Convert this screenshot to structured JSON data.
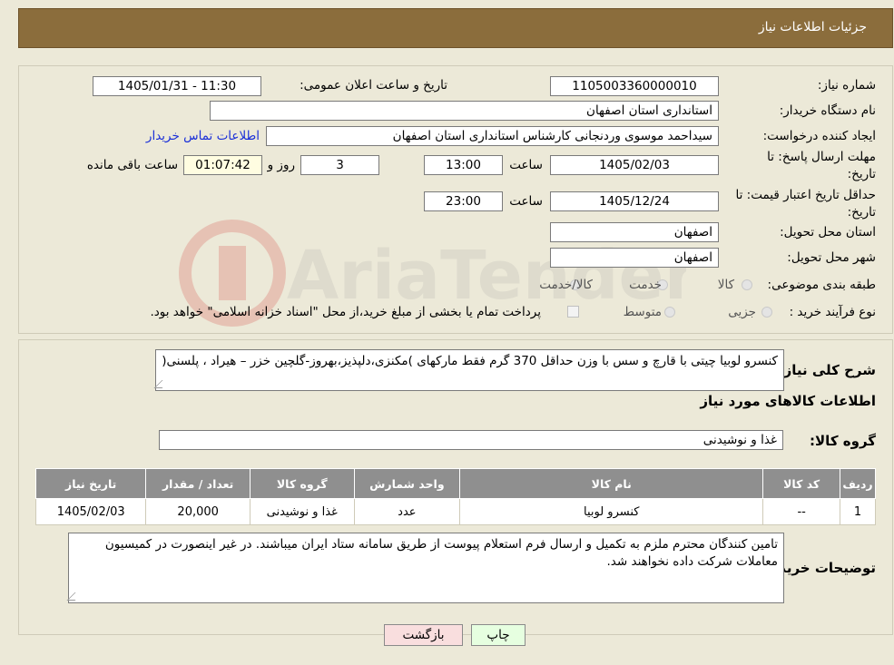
{
  "header": {
    "title": "جزئیات اطلاعات نیاز"
  },
  "fields": {
    "need_number_label": "شماره نیاز:",
    "need_number": "1105003360000010",
    "announce_label": "تاریخ و ساعت اعلان عمومی:",
    "announce_value": "1405/01/31 - 11:30",
    "buyer_org_label": "نام دستگاه خریدار:",
    "buyer_org": "استانداری استان اصفهان",
    "creator_label": "ایجاد کننده درخواست:",
    "creator": "سیداحمد موسوی وردنجانی کارشناس استانداری استان اصفهان",
    "contact_link": "اطلاعات تماس خریدار",
    "deadline_label_1": "مهلت ارسال پاسخ: تا",
    "deadline_label_2": "تاریخ:",
    "deadline_date": "1405/02/03",
    "time_label": "ساعت",
    "deadline_time": "13:00",
    "days_value": "3",
    "days_label": "روز و",
    "remaining_time": "01:07:42",
    "remaining_label": "ساعت باقی مانده",
    "validity_label_1": "حداقل تاریخ اعتبار قیمت: تا",
    "validity_label_2": "تاریخ:",
    "validity_date": "1405/12/24",
    "validity_time_label": "ساعت",
    "validity_time": "23:00",
    "province_label": "استان محل تحویل:",
    "province": "اصفهان",
    "city_label": "شهر محل تحویل:",
    "city": "اصفهان",
    "category_label": "طبقه بندی موضوعی:",
    "category_options": [
      "کالا",
      "خدمت",
      "کالا/خدمت"
    ],
    "process_label": "نوع فرآیند خرید :",
    "process_options": [
      "جزیی",
      "متوسط"
    ],
    "process_note": "پرداخت تمام یا بخشی از مبلغ خرید،از محل \"اسناد خزانه اسلامی\" خواهد بود."
  },
  "summary": {
    "label": "شرح کلی نیاز:",
    "text": "کنسرو لوبیا چیتی با قارچ و سس با وزن حداقل 370 گرم فقط مارکهای )مکنزی،دلپذیز،بهروز-گلچین خزر – هیراد ، پلسنی("
  },
  "goods": {
    "section_title": "اطلاعات کالاهای مورد نیاز",
    "group_label": "گروه کالا:",
    "group_value": "غذا و نوشیدنی",
    "table_headers": [
      "ردیف",
      "کد کالا",
      "نام کالا",
      "واحد شمارش",
      "گروه کالا",
      "تعداد / مقدار",
      "تاریخ نیاز"
    ],
    "rows": [
      [
        "1",
        "--",
        "کنسرو لوبیا",
        "عدد",
        "غذا و نوشیدنی",
        "20,000",
        "1405/02/03"
      ]
    ]
  },
  "buyer_notes": {
    "label": "توضیحات خریدار:",
    "text": "تامین کنندگان محترم ملزم به تکمیل و ارسال فرم استعلام پیوست از طریق سامانه ستاد ایران میباشند. در غیر اینصورت در کمیسیون معاملات شرکت داده نخواهند شد."
  },
  "buttons": {
    "print": "چاپ",
    "back": "بازگشت"
  },
  "colors": {
    "header_bg": "#8b6d3c",
    "link": "#1a2fd8",
    "back_btn": "#f9dede",
    "print_btn": "#e6ffe0"
  }
}
